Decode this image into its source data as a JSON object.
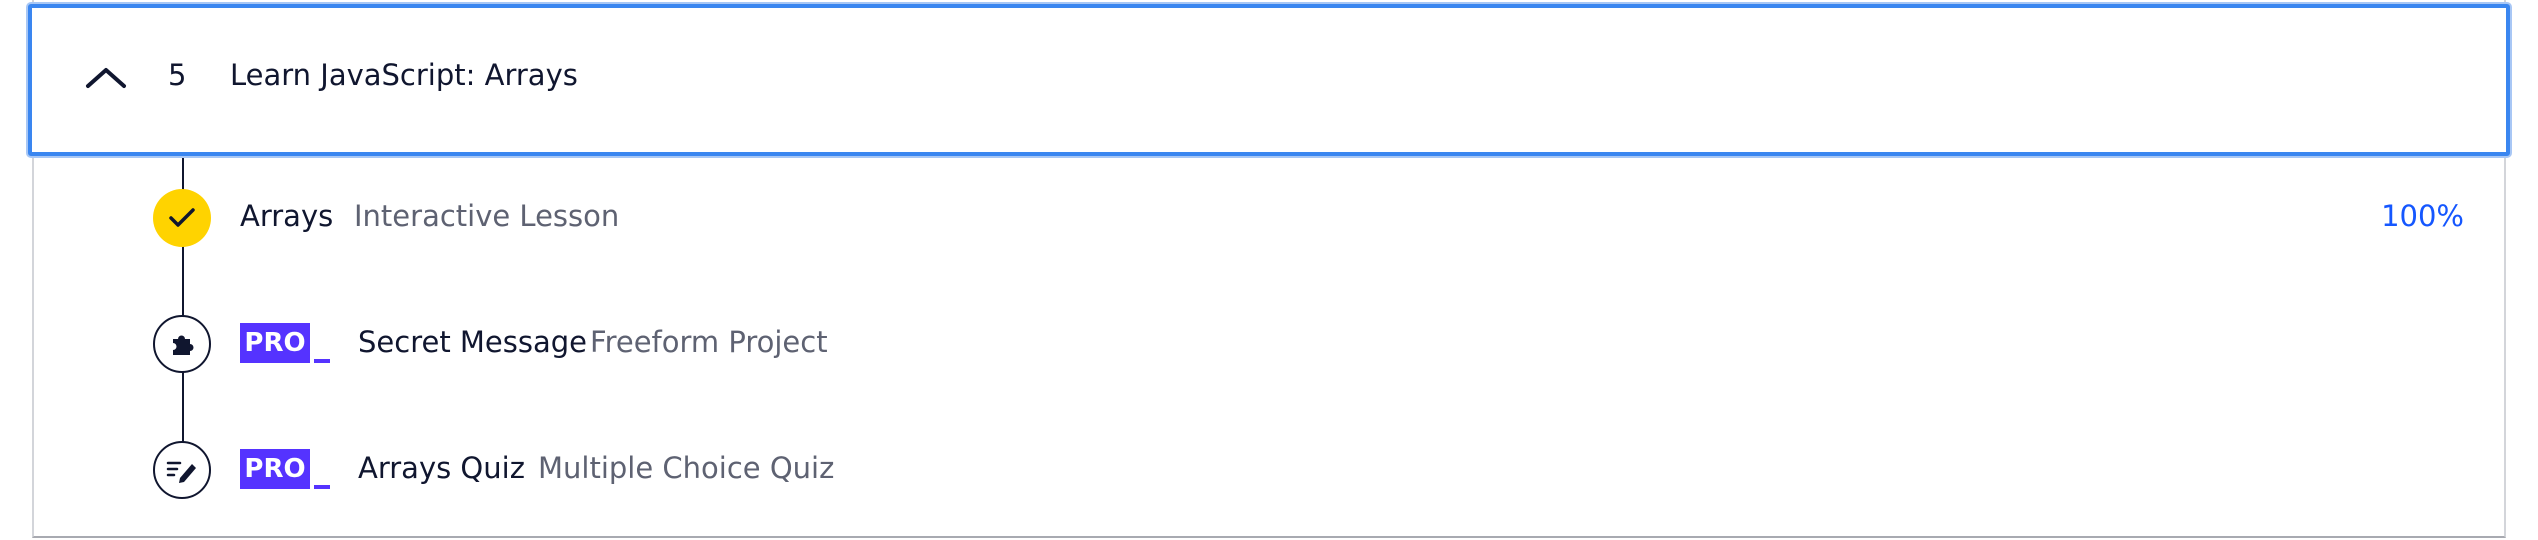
{
  "module": {
    "number": "5",
    "title": "Learn JavaScript: Arrays",
    "expanded": true,
    "icon": "chevron-up-icon"
  },
  "items": [
    {
      "name": "Arrays",
      "type": "Interactive Lesson",
      "status": "completed",
      "icon": "check-icon",
      "progress": "100%",
      "pro": false
    },
    {
      "name": "Secret Message",
      "type": "Freeform Project",
      "status": "locked",
      "icon": "puzzle-icon",
      "pro": true,
      "pro_label": "PRO"
    },
    {
      "name": "Arrays Quiz",
      "type": "Multiple Choice Quiz",
      "status": "locked",
      "icon": "quiz-pencil-icon",
      "pro": true,
      "pro_label": "PRO"
    }
  ],
  "colors": {
    "focus_border": "#3a86f0",
    "completed_circle": "#ffd300",
    "pro_badge": "#5533ff",
    "progress_text": "#1557ff",
    "secondary_text": "#5e6272"
  }
}
